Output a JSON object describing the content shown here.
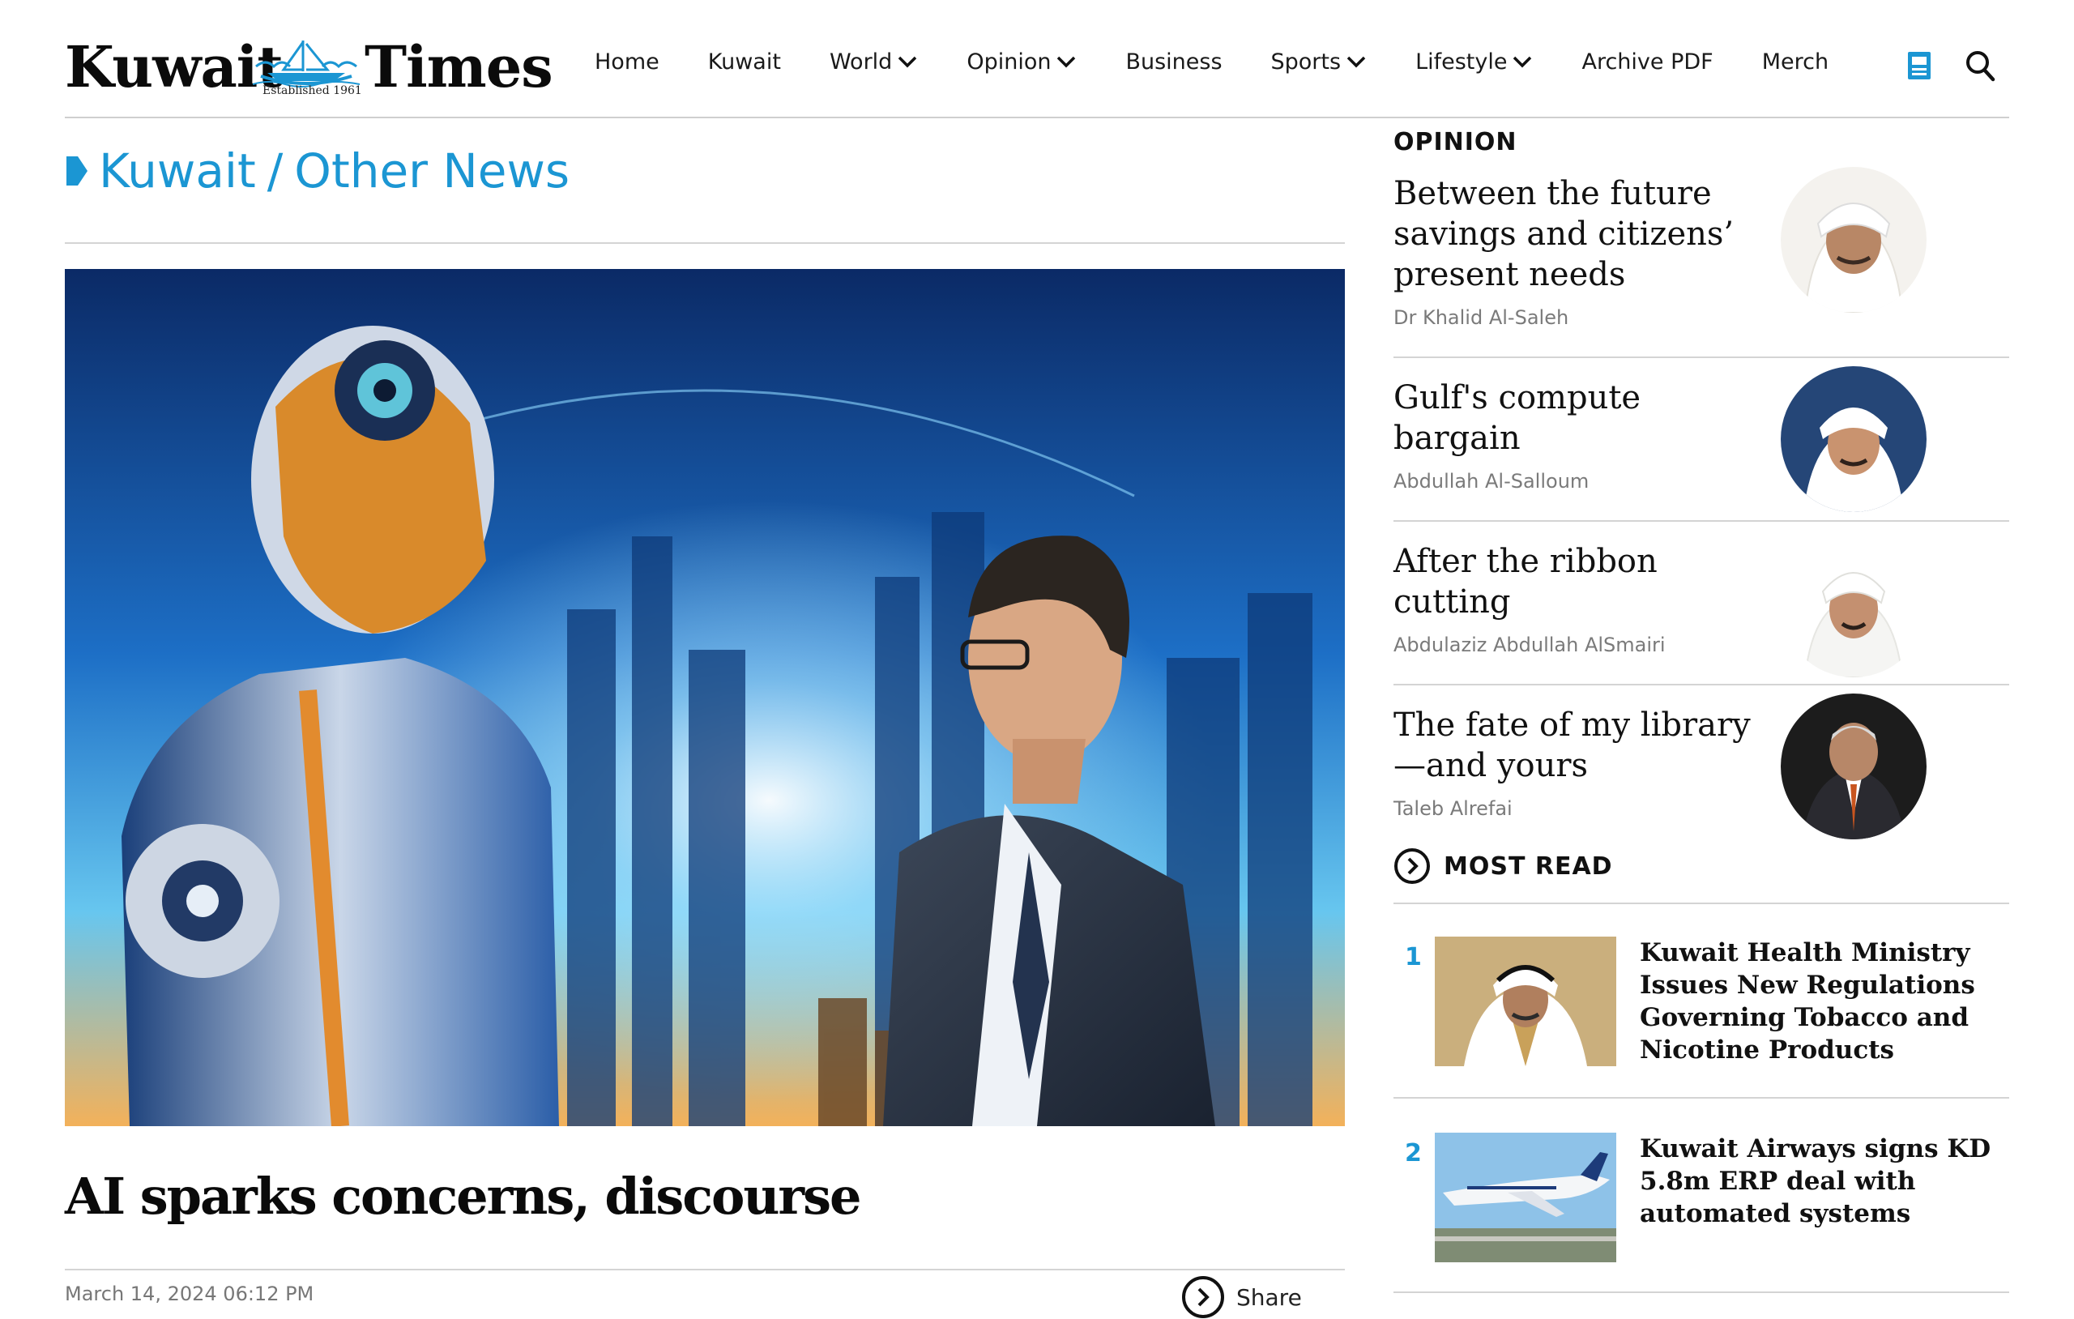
{
  "header": {
    "logo": {
      "word_left": "Kuwait",
      "word_right": "Times",
      "established": "Established 1961"
    },
    "nav": [
      {
        "label": "Home",
        "has_dropdown": false
      },
      {
        "label": "Kuwait",
        "has_dropdown": false
      },
      {
        "label": "World",
        "has_dropdown": true
      },
      {
        "label": "Opinion",
        "has_dropdown": true
      },
      {
        "label": "Business",
        "has_dropdown": false
      },
      {
        "label": "Sports",
        "has_dropdown": true
      },
      {
        "label": "Lifestyle",
        "has_dropdown": true
      },
      {
        "label": "Archive PDF",
        "has_dropdown": false
      },
      {
        "label": "Merch",
        "has_dropdown": false
      }
    ],
    "icons": [
      "epaper-icon",
      "search-icon"
    ]
  },
  "article": {
    "breadcrumb": {
      "section": "Kuwait",
      "subsection": "Other News"
    },
    "headline": "AI sparks concerns, discourse",
    "dateline": "March 14, 2024 06:12 PM",
    "share_label": "Share"
  },
  "sidebar": {
    "opinion": {
      "heading": "OPINION",
      "items": [
        {
          "title": "Between the future savings and citizens’ present needs",
          "author": "Dr Khalid Al-Saleh"
        },
        {
          "title": "Gulf's compute bargain",
          "author": "Abdullah Al-Salloum"
        },
        {
          "title": "After the ribbon cutting",
          "author": "Abdulaziz Abdullah AlSmairi"
        },
        {
          "title": "The fate of my library—and yours",
          "author": "Taleb Alrefai"
        }
      ]
    },
    "most_read": {
      "heading": "MOST READ",
      "items": [
        {
          "rank": "1",
          "title": "Kuwait Health Ministry Issues New Regulations Governing Tobacco and Nicotine Products"
        },
        {
          "rank": "2",
          "title": "Kuwait Airways signs KD 5.8m ERP deal with automated systems"
        }
      ]
    }
  },
  "colors": {
    "accent": "#1b96d3",
    "text": "#111111",
    "muted": "#7a7a7a",
    "rule": "#d4d4d4"
  }
}
